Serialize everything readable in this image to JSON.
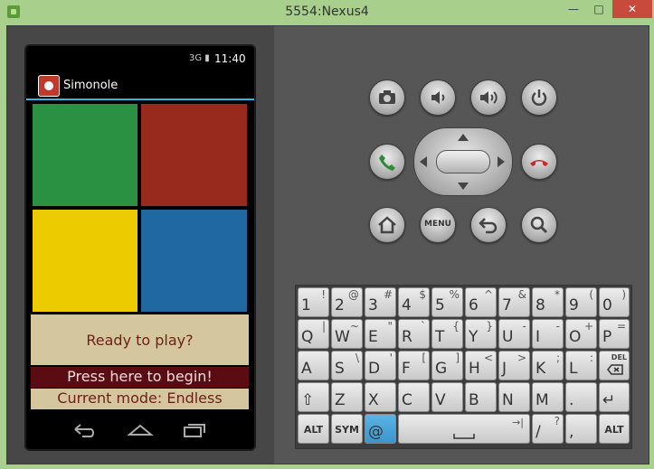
{
  "window": {
    "title": "5554:Nexus4",
    "minimize": "—",
    "maximize": "□",
    "close": "✕"
  },
  "phone": {
    "status": {
      "icons": "3G ▮",
      "time": "11:40"
    },
    "app": {
      "title": "Simonole"
    },
    "tiles": [
      "green",
      "red",
      "yellow",
      "blue"
    ],
    "colors": {
      "green": "#2b9142",
      "red": "#972a1c",
      "yellow": "#eccb00",
      "blue": "#1f68a2"
    },
    "ready_text": "Ready to play?",
    "begin_text": "Press here to begin!",
    "mode_text": "Current mode: Endless"
  },
  "controls": {
    "top": [
      "camera-icon",
      "volume-down-icon",
      "volume-up-icon",
      "power-icon"
    ],
    "mid": [
      "call-icon",
      "dpad",
      "end-call-icon"
    ],
    "bottom": [
      "home-icon",
      "menu",
      "back-icon",
      "search-icon"
    ],
    "menu_label": "MENU"
  },
  "keyboard": {
    "row1": [
      [
        "1",
        "!"
      ],
      [
        "2",
        "@"
      ],
      [
        "3",
        "#"
      ],
      [
        "4",
        "$"
      ],
      [
        "5",
        "%"
      ],
      [
        "6",
        "^"
      ],
      [
        "7",
        "&"
      ],
      [
        "8",
        "*"
      ],
      [
        "9",
        "("
      ],
      [
        "0",
        ")"
      ]
    ],
    "row2": [
      [
        "Q",
        "|"
      ],
      [
        "W",
        "~"
      ],
      [
        "E",
        "\""
      ],
      [
        "R",
        "`"
      ],
      [
        "T",
        "{"
      ],
      [
        "Y",
        "}"
      ],
      [
        "U",
        "-"
      ],
      [
        "I",
        "-"
      ],
      [
        "O",
        "+"
      ],
      [
        "P",
        "="
      ]
    ],
    "row3": [
      [
        "A",
        ""
      ],
      [
        "S",
        "\\"
      ],
      [
        "D",
        "'"
      ],
      [
        "F",
        "["
      ],
      [
        "G",
        "]"
      ],
      [
        "H",
        "<"
      ],
      [
        "J",
        ">"
      ],
      [
        "K",
        ";"
      ],
      [
        "L",
        ":"
      ],
      [
        "DEL",
        ""
      ]
    ],
    "row4": [
      [
        "⇧",
        ""
      ],
      [
        "Z",
        ""
      ],
      [
        "X",
        ""
      ],
      [
        "C",
        ""
      ],
      [
        "V",
        ""
      ],
      [
        "B",
        ""
      ],
      [
        "N",
        ""
      ],
      [
        "M",
        ""
      ],
      [
        ".",
        ""
      ],
      [
        "↵",
        ""
      ]
    ],
    "row5": {
      "alt": "ALT",
      "sym": "SYM",
      "at": "@",
      "space_arrow": "→|",
      "slash": "/",
      "slash_alt": "?",
      "comma": ",",
      "alt2": "ALT"
    }
  }
}
